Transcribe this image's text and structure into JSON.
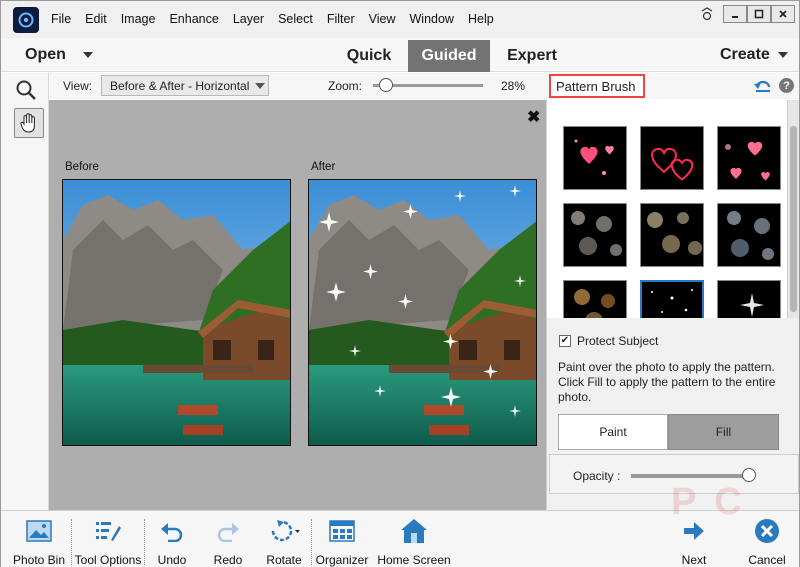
{
  "menubar": {
    "items": [
      "File",
      "Edit",
      "Image",
      "Enhance",
      "Layer",
      "Select",
      "Filter",
      "View",
      "Window",
      "Help"
    ],
    "window_controls": {
      "help_icon": "help-icon",
      "minimize": "minimize-icon",
      "maximize": "maximize-icon",
      "close": "close-icon"
    }
  },
  "modebar": {
    "open_label": "Open",
    "tabs": [
      {
        "label": "Quick",
        "active": false
      },
      {
        "label": "Guided",
        "active": true
      },
      {
        "label": "Expert",
        "active": false
      }
    ],
    "create_label": "Create"
  },
  "options": {
    "view_label": "View:",
    "view_value": "Before & After - Horizontal",
    "zoom_label": "Zoom:",
    "zoom_value": "28%",
    "zoom_fraction": 0.05,
    "panel_title": "Pattern Brush"
  },
  "canvas": {
    "before_label": "Before",
    "after_label": "After"
  },
  "panel": {
    "pattern_thumbs": [
      "pink-hearts",
      "red-heart-outlines",
      "pink-hearts-bokeh",
      "grey-bokeh",
      "gold-bokeh",
      "blue-bokeh",
      "orange-bokeh",
      "star-sparkles",
      "white-sparkles"
    ],
    "protect_subject_label": "Protect Subject",
    "protect_subject_checked": true,
    "instructions": "Paint over the photo to apply the pattern. Click Fill to apply the pattern to the entire photo.",
    "paint_label": "Paint",
    "fill_label": "Fill",
    "opacity_label": "Opacity :",
    "opacity_fraction": 0.95
  },
  "bottombar": {
    "photo_bin": "Photo Bin",
    "tool_options": "Tool Options",
    "undo": "Undo",
    "redo": "Redo",
    "rotate": "Rotate",
    "organizer": "Organizer",
    "home_screen": "Home Screen",
    "next": "Next",
    "cancel": "Cancel"
  },
  "colors": {
    "accent": "#2a7ac0",
    "active_tab": "#737373",
    "highlight_box": "#ee4444"
  }
}
